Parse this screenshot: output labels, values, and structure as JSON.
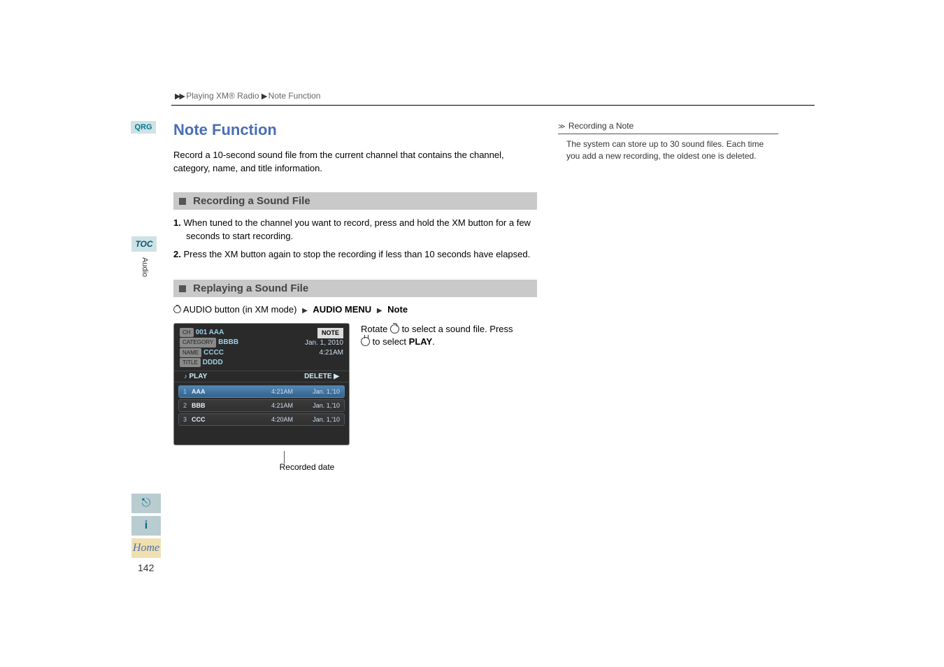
{
  "breadcrumb": {
    "seg1": "Playing XM® Radio",
    "seg2": "Note Function"
  },
  "badges": {
    "qrg": "QRG",
    "toc": "TOC",
    "side_label": "Audio",
    "home": "Home"
  },
  "heading": "Note Function",
  "intro": "Record a 10-second sound file from the current channel that contains the channel, category, name, and title information.",
  "section1": {
    "title": "Recording a Sound File",
    "step1_num": "1.",
    "step1": "When tuned to the channel you want to record, press and hold the XM button for a few seconds to start recording.",
    "step2_num": "2.",
    "step2": "Press the XM button again to stop the recording if less than 10 seconds have elapsed."
  },
  "section2": {
    "title": "Replaying a Sound File",
    "path_prefix": "AUDIO button (in XM mode)",
    "path_item1": "AUDIO MENU",
    "path_item2": "Note",
    "rotate_text": "Rotate",
    "rotate_rest": " to select a sound file. Press",
    "press_rest": " to select ",
    "play_word": "PLAY",
    "period": "."
  },
  "screen": {
    "ch_label": "CH",
    "ch_value": "001 AAA",
    "cat_label": "CATEGORY",
    "cat_value": "BBBB",
    "name_label": "NAME",
    "name_value": "CCCC",
    "title_label": "TITLE",
    "title_value": "DDDD",
    "note_badge": "NOTE",
    "date": "Jan. 1, 2010",
    "time": "4:21AM",
    "play_btn": "PLAY",
    "delete_btn": "DELETE",
    "rows": [
      {
        "idx": "1",
        "name": "AAA",
        "time": "4:21AM",
        "date": "Jan. 1,'10"
      },
      {
        "idx": "2",
        "name": "BBB",
        "time": "4:21AM",
        "date": "Jan. 1,'10"
      },
      {
        "idx": "3",
        "name": "CCC",
        "time": "4:20AM",
        "date": "Jan. 1,'10"
      }
    ]
  },
  "recorded_caption": "Recorded date",
  "sidebar_tip": {
    "title": "Recording a Note",
    "body": "The system can store up to 30 sound files. Each time you add a new recording, the oldest one is deleted."
  },
  "page_number": "142"
}
